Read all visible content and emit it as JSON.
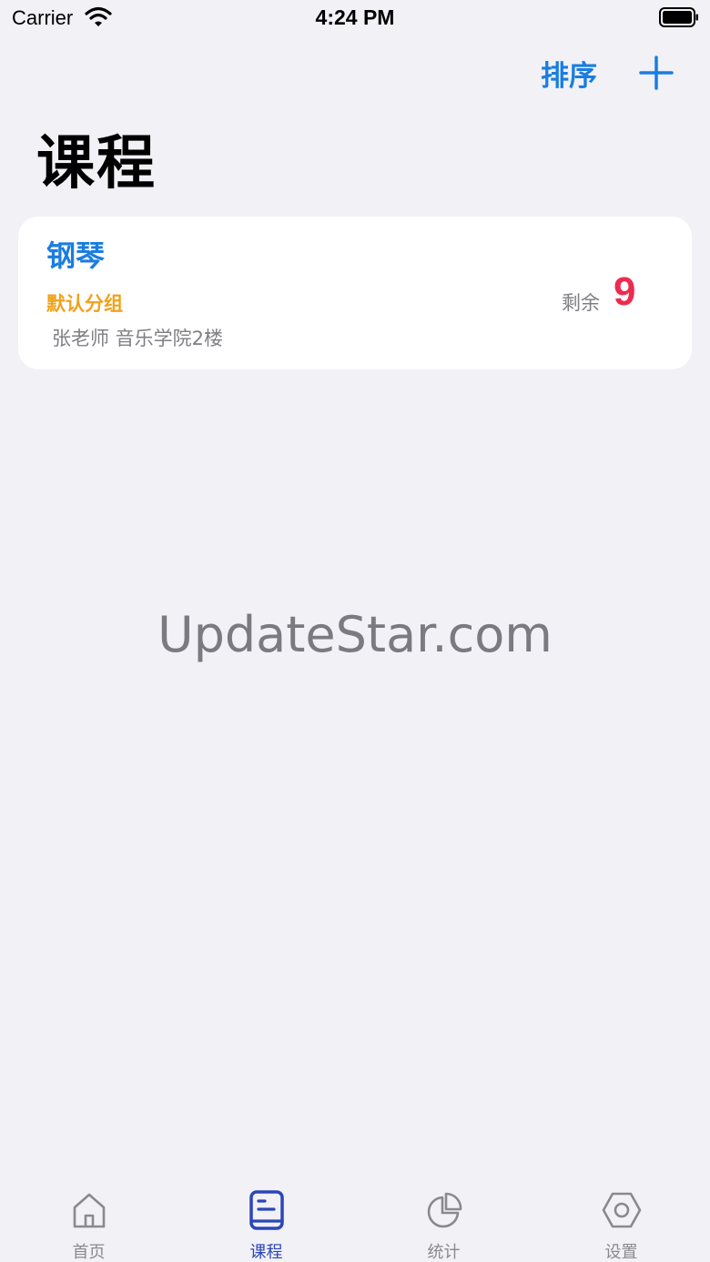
{
  "status_bar": {
    "carrier": "Carrier",
    "time": "4:24 PM"
  },
  "nav": {
    "sort_label": "排序",
    "add_icon": "plus-icon",
    "title": "课程"
  },
  "courses": [
    {
      "name": "钢琴",
      "group": "默认分组",
      "detail": "张老师 音乐学院2楼",
      "remaining_label": "剩余",
      "remaining_value": "9"
    }
  ],
  "watermark": "UpdateStar.com",
  "tabs": [
    {
      "label": "首页",
      "icon": "home-icon",
      "active": false
    },
    {
      "label": "课程",
      "icon": "book-icon",
      "active": true
    },
    {
      "label": "统计",
      "icon": "pie-chart-icon",
      "active": false
    },
    {
      "label": "设置",
      "icon": "gear-icon",
      "active": false
    }
  ],
  "colors": {
    "accent": "#1a7de0",
    "group": "#f0a21a",
    "remaining": "#ee2a4f",
    "tab_active": "#2c46b8",
    "tab_inactive": "#8a8a8e",
    "background": "#f1f1f6"
  }
}
